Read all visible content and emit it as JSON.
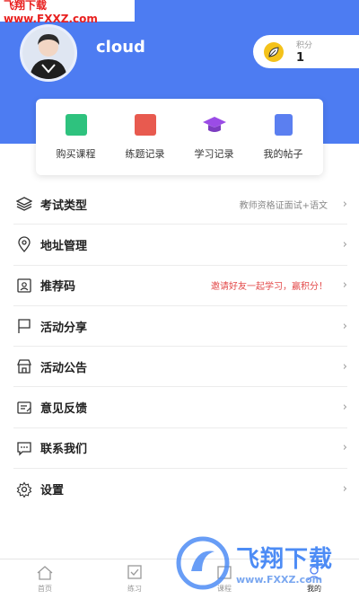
{
  "watermark": {
    "top": "飞翔下载 www.FXXZ.com",
    "brand": "飞翔下载",
    "url": "www.FXXZ.com"
  },
  "profile": {
    "name": "cloud",
    "points_label": "积分",
    "points_value": "1"
  },
  "quick_actions": [
    {
      "label": "购买课程",
      "icon": "book-icon",
      "color": "#2ec27e"
    },
    {
      "label": "练题记录",
      "icon": "clipboard-icon",
      "color": "#e85a4f"
    },
    {
      "label": "学习记录",
      "icon": "graduation-cap-icon",
      "color": "#9b4ce6"
    },
    {
      "label": "我的帖子",
      "icon": "list-icon",
      "color": "#5b7ff0"
    }
  ],
  "menu": [
    {
      "label": "考试类型",
      "value": "教师资格证面试+语文",
      "icon": "layers-icon"
    },
    {
      "label": "地址管理",
      "value": "",
      "icon": "location-pin-icon"
    },
    {
      "label": "推荐码",
      "value": "邀请好友一起学习，赢积分！",
      "icon": "referral-icon"
    },
    {
      "label": "活动分享",
      "value": "",
      "icon": "flag-icon"
    },
    {
      "label": "活动公告",
      "value": "",
      "icon": "shop-icon"
    },
    {
      "label": "意见反馈",
      "value": "",
      "icon": "feedback-icon"
    },
    {
      "label": "联系我们",
      "value": "",
      "icon": "chat-icon"
    },
    {
      "label": "设置",
      "value": "",
      "icon": "gear-icon"
    }
  ],
  "tabs": [
    {
      "label": "首页",
      "icon": "home-icon",
      "active": false
    },
    {
      "label": "练习",
      "icon": "checkbox-icon",
      "active": false
    },
    {
      "label": "课程",
      "icon": "course-icon",
      "active": false
    },
    {
      "label": "我的",
      "icon": "user-icon",
      "active": true
    }
  ],
  "colors": {
    "header_blue": "#4d7cf2",
    "accent_yellow": "#f4c21a",
    "invite_red": "#e34a4a"
  }
}
